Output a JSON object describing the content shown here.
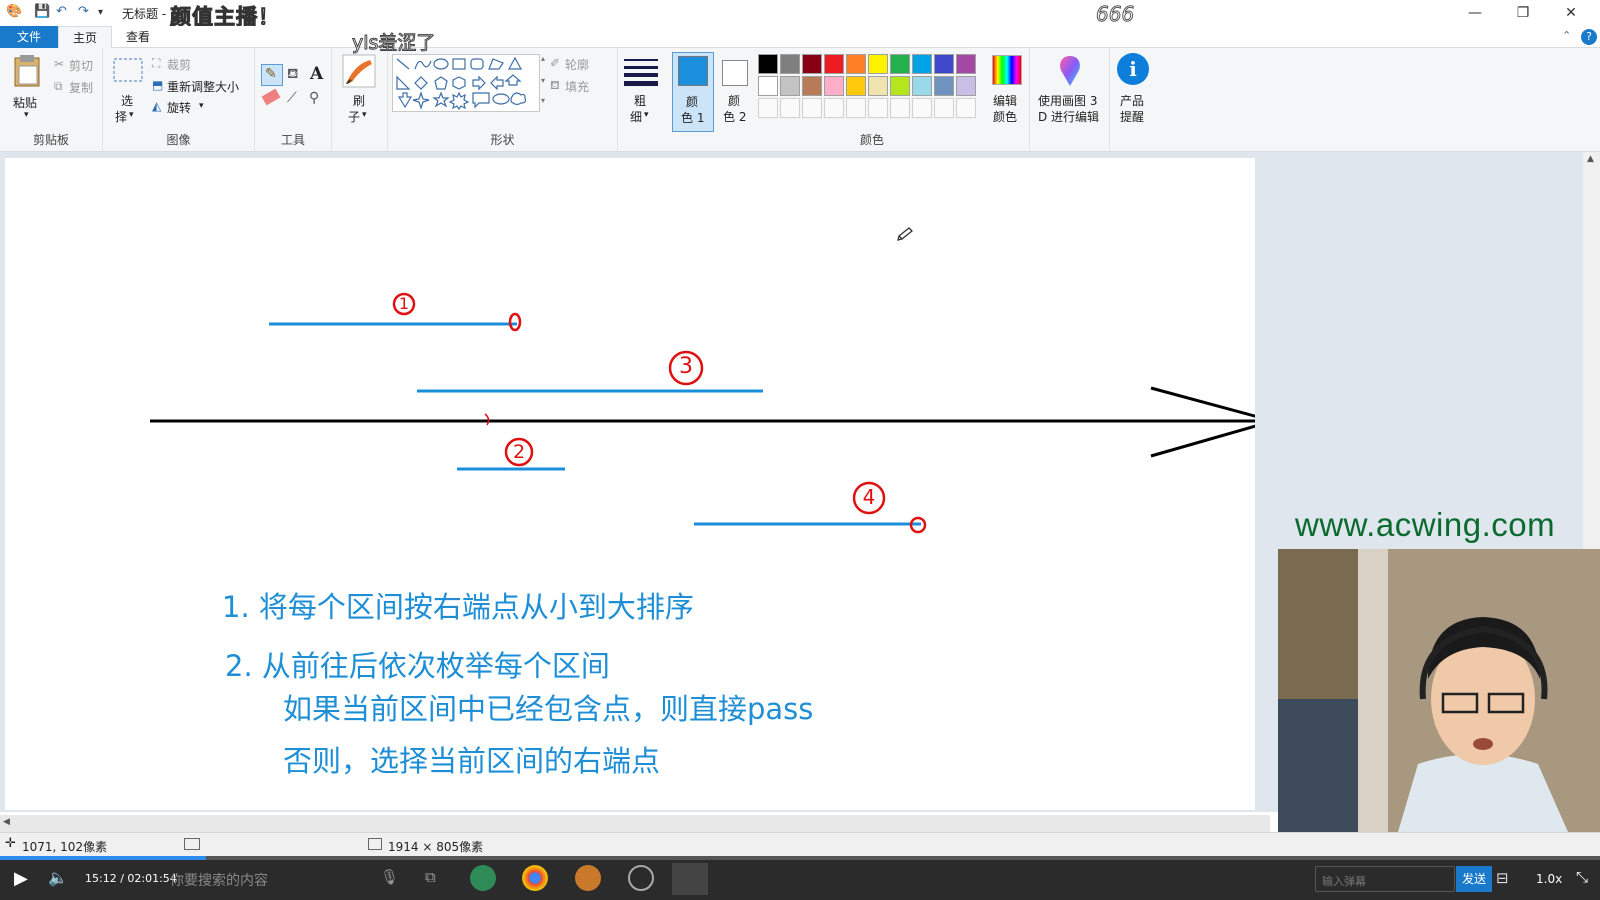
{
  "titlebar": {
    "doc_title": "无标题 -",
    "overlay_title": "颜值主播！",
    "overlay_666": "666",
    "overlay_yls": "yls羞涩了",
    "minimize": "—",
    "restore": "❐",
    "close": "✕"
  },
  "tabs": {
    "file": "文件",
    "home": "主页",
    "view": "查看"
  },
  "ribbon": {
    "clipboard": {
      "paste": "粘贴",
      "cut": "剪切",
      "copy": "复制",
      "label": "剪贴板"
    },
    "image": {
      "select": "选",
      "select2": "择",
      "crop": "裁剪",
      "resize": "重新调整大小",
      "rotate": "旋转",
      "label": "图像"
    },
    "tools": {
      "label": "工具",
      "text_tool": "A"
    },
    "brush": {
      "line1": "刷",
      "line2": "子"
    },
    "shapes": {
      "outline": "轮廓",
      "fill": "填充",
      "label": "形状"
    },
    "size": {
      "line1": "粗",
      "line2": "细"
    },
    "color1": {
      "line1": "颜",
      "line2": "色 1"
    },
    "color2": {
      "line1": "颜",
      "line2": "色 2"
    },
    "colors": {
      "label": "颜色",
      "row1": [
        "#000000",
        "#7f7f7f",
        "#880015",
        "#ed1c24",
        "#ff7f27",
        "#fff200",
        "#22b14c",
        "#00a2e8",
        "#3f48cc",
        "#a349a4"
      ],
      "row2": [
        "#ffffff",
        "#c3c3c3",
        "#b97a57",
        "#ffaec9",
        "#ffc90e",
        "#efe4b0",
        "#b5e61d",
        "#99d9ea",
        "#7092be",
        "#c8bfe7"
      ]
    },
    "edit_colors": {
      "line1": "编辑",
      "line2": "颜色"
    },
    "paint3d": {
      "line1": "使用画图 3",
      "line2": "D 进行编辑"
    },
    "alert": {
      "line1": "产品",
      "line2": "提醒"
    }
  },
  "canvas": {
    "labels": {
      "one": "1",
      "three": "3",
      "two": "2",
      "four": "4"
    },
    "steps": {
      "step1": "1. 将每个区间按右端点从小到大排序",
      "step2": "2. 从前往后依次枚举每个区间",
      "step2a": "如果当前区间中已经包含点，则直接pass",
      "step2b": "否则，选择当前区间的右端点"
    },
    "watermark": "www.acwing.com",
    "colors": {
      "segment": "#1b8fdc",
      "axis": "#000000",
      "mark": "#e01010",
      "text": "#1e8fd6"
    }
  },
  "status": {
    "cursor_pos": "1071, 102像素",
    "canvas_size": "1914 × 805像素"
  },
  "player": {
    "time": "15:12 / 02:01:54",
    "search_placeholder": "你要搜索的内容",
    "send": "发送",
    "speed": "1.0x",
    "danmaku_placeholder": "输入弹幕"
  }
}
